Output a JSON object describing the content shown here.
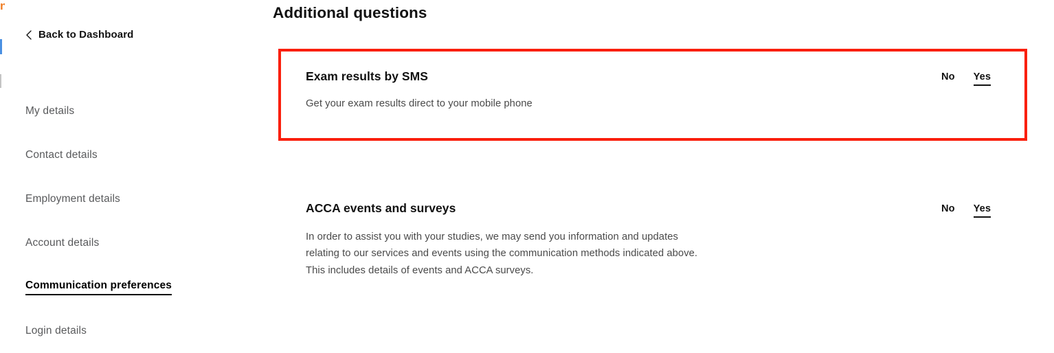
{
  "sidebar": {
    "back_link": {
      "label": "Back to Dashboard",
      "icon": "chevron-left-icon"
    },
    "items": [
      {
        "label": "My details",
        "active": false
      },
      {
        "label": "Contact details",
        "active": false
      },
      {
        "label": "Employment details",
        "active": false
      },
      {
        "label": "Account details",
        "active": false
      },
      {
        "label": "Communication preferences",
        "active": true
      },
      {
        "label": "Login details",
        "active": false
      }
    ]
  },
  "main": {
    "page_title": "Additional questions",
    "questions": [
      {
        "title": "Exam results by SMS",
        "description_lines": [
          "Get your exam results direct to your mobile phone"
        ],
        "options": {
          "no": "No",
          "yes": "Yes"
        },
        "selected": "Yes",
        "highlighted": true
      },
      {
        "title": "ACCA events and surveys",
        "description_lines": [
          "In order to assist you with your studies, we may send you information and updates",
          "relating to our services and events using the communication methods indicated above.",
          "This includes details of events and ACCA surveys."
        ],
        "options": {
          "no": "No",
          "yes": "Yes"
        },
        "selected": "Yes",
        "highlighted": false
      }
    ]
  },
  "colors": {
    "highlight_red": "#fa1f0c",
    "text_primary": "#111111",
    "text_body": "#4a4a4a",
    "text_muted": "#58595b",
    "logo_orange": "#f07c22",
    "rule_blue": "#4a90e2",
    "rule_grey": "#c4c4c4"
  },
  "edge_artifacts": {
    "logo_fragment_glyph": "n"
  }
}
